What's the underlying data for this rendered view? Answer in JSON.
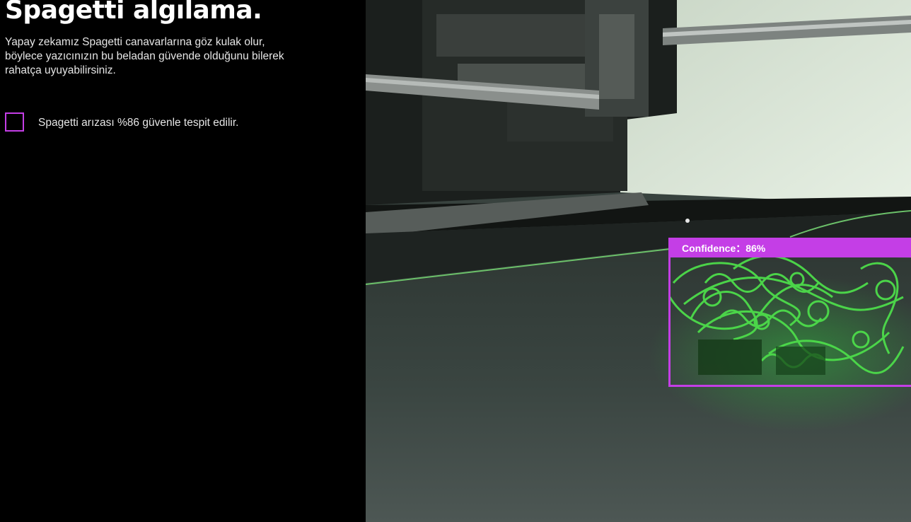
{
  "panel": {
    "title": "Spagetti algılama.",
    "description": "Yapay zekamız Spagetti canavarlarına göz kulak olur, böylece yazıcınızın bu beladan güvende olduğunu bilerek rahatça uyuyabilirsiniz.",
    "legend_text": "Spagetti arızası %86 güvenle tespit edilir.",
    "accent_color": "#c43ee6"
  },
  "camera": {
    "detection_label": "Confidence：86%",
    "detection_color": "#c43ee6",
    "filament_color": "#4ddc4a"
  }
}
